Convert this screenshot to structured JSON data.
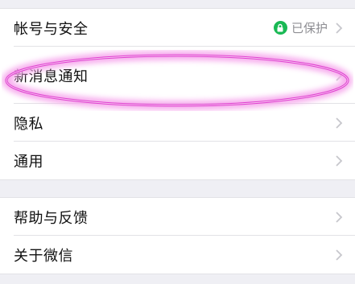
{
  "settings": {
    "group1": [
      {
        "label": "帐号与安全",
        "status": "已保护"
      },
      {
        "label": "新消息通知"
      },
      {
        "label": "隐私"
      },
      {
        "label": "通用"
      }
    ],
    "group2": [
      {
        "label": "帮助与反馈"
      },
      {
        "label": "关于微信"
      }
    ]
  },
  "colors": {
    "background": "#efeff4",
    "row": "#ffffff",
    "status_green": "#19b954",
    "highlight": "#e040d0"
  },
  "icons": [
    "lock-icon",
    "chevron-right-icon"
  ]
}
